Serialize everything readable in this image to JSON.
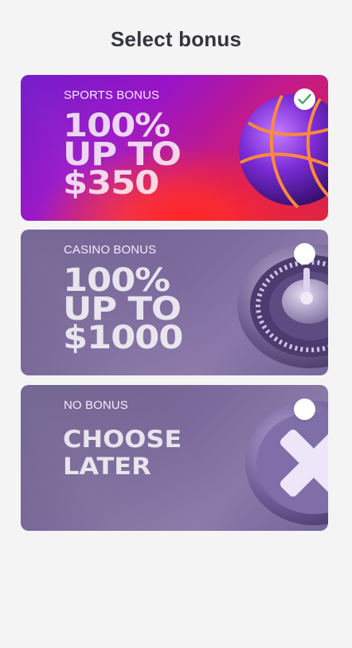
{
  "page": {
    "title": "Select bonus"
  },
  "bonuses": [
    {
      "label": "SPORTS BONUS",
      "headline_lines": [
        "100%",
        "UP TO",
        "$350"
      ],
      "selected": true,
      "art_icon": "basketball-icon"
    },
    {
      "label": "CASINO BONUS",
      "headline_lines": [
        "100%",
        "UP TO",
        "$1000"
      ],
      "selected": false,
      "art_icon": "roulette-wheel-icon"
    },
    {
      "label": "NO BONUS",
      "headline_lines": [
        "CHOOSE",
        "LATER"
      ],
      "selected": false,
      "art_icon": "cross-coin-icon"
    }
  ],
  "colors": {
    "background": "#f4f4f4",
    "title": "#34353d",
    "check": "#3aa35b",
    "sports_gradient_start": "#6c10c8",
    "sports_gradient_end": "#ff1e1e",
    "muted_card": "#7b6a9b"
  }
}
